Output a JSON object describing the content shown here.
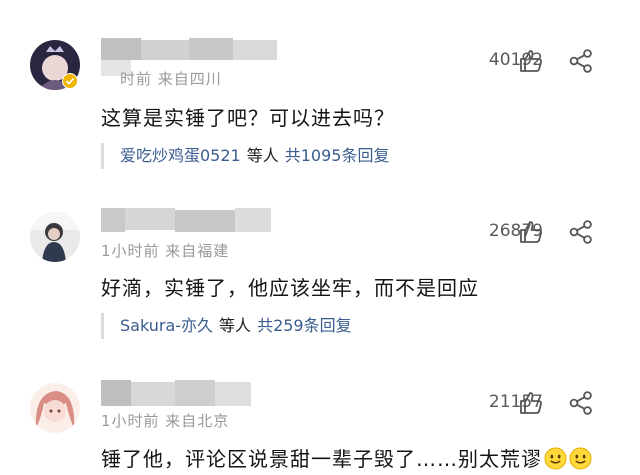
{
  "comments": [
    {
      "meta": "时前  来自四川",
      "text": "这算是实锤了吧？可以进去吗？",
      "reply_nick": "爱吃炒鸡蛋0521",
      "reply_mid": "等人",
      "reply_count": "共1095条回复",
      "likes": "40192",
      "icons": {
        "like": "thumbs-up-icon",
        "share": "share-icon"
      }
    },
    {
      "meta": "1小时前  来自福建",
      "text": "好滴，实锤了，他应该坐牢，而不是回应",
      "reply_nick": "Sakura-亦久",
      "reply_mid": "等人",
      "reply_count": "共259条回复",
      "likes": "26879",
      "icons": {
        "like": "thumbs-up-icon",
        "share": "share-icon"
      }
    },
    {
      "meta": "1小时前  来自北京",
      "text": "锤了他，评论区说景甜一辈子毁了……别太荒谬",
      "emojis": [
        "smile-emoji",
        "smile-emoji"
      ],
      "likes": "21157",
      "icons": {
        "like": "thumbs-up-icon",
        "share": "share-icon"
      }
    }
  ],
  "colors": {
    "link": "#3a5d8f",
    "meta": "#9a9a9a",
    "badge": "#f2b600"
  }
}
